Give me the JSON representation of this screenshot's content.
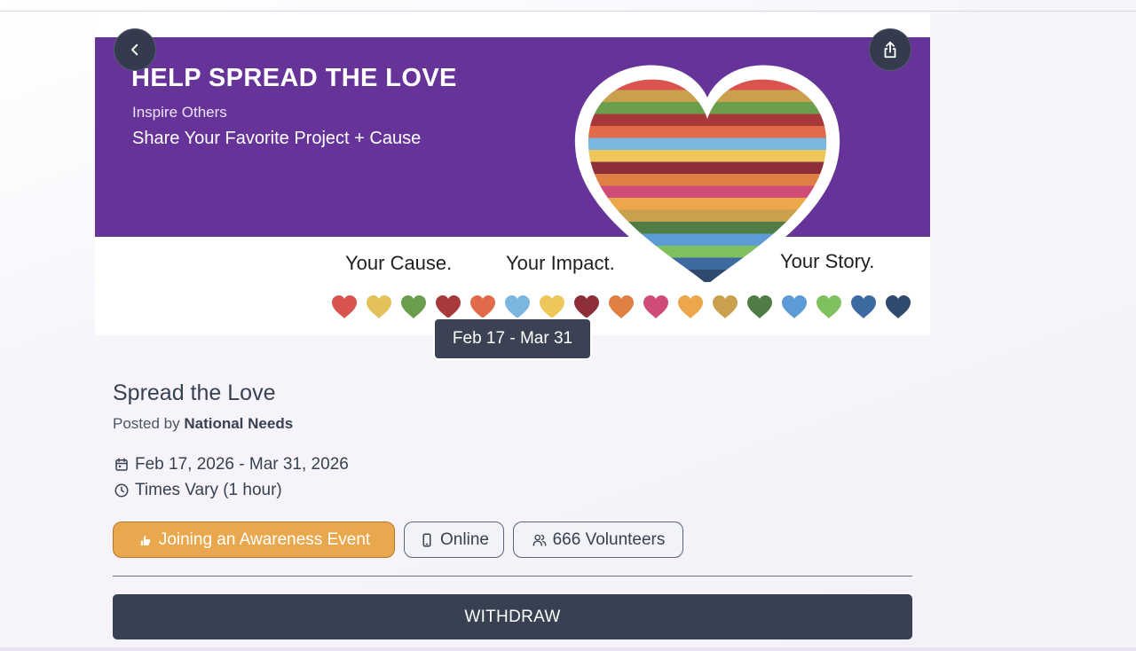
{
  "banner": {
    "title": "HELP SPREAD THE LOVE",
    "line1": "Inspire Others",
    "line2": "Share Your Favorite Project + Cause",
    "taglines": [
      "Your Cause.",
      "Your Impact.",
      "Your Story."
    ],
    "heart_colors": [
      "#d9534f",
      "#e3c25c",
      "#6a9e4c",
      "#a8393b",
      "#e06a4a",
      "#7ab6de",
      "#eec75a",
      "#8c2f3b",
      "#e07f43",
      "#cf4c77",
      "#eca74a",
      "#c9a04e",
      "#4f7d45",
      "#5d9bd6",
      "#7ec15e",
      "#3c6aa1",
      "#2f4a6e"
    ]
  },
  "date_badge": "Feb 17 - Mar 31",
  "event": {
    "title": "Spread the Love",
    "posted_prefix": "Posted by",
    "organization": "National Needs",
    "date_range": "Feb 17, 2026 - Mar 31, 2026",
    "time": "Times Vary (1 hour)"
  },
  "chips": {
    "category": "Joining an Awareness Event",
    "mode": "Online",
    "volunteers": "666 Volunteers"
  },
  "actions": {
    "withdraw_label": "WITHDRAW"
  },
  "icons": {
    "back": "chevron-left-icon",
    "share": "share-icon",
    "calendar": "calendar-icon",
    "clock": "clock-icon",
    "category": "hand-icon",
    "mode": "phone-icon",
    "volunteers": "users-icon"
  },
  "colors": {
    "banner_purple": "#663399",
    "category_chip": "#e9a84d",
    "dark_button": "#374151"
  }
}
